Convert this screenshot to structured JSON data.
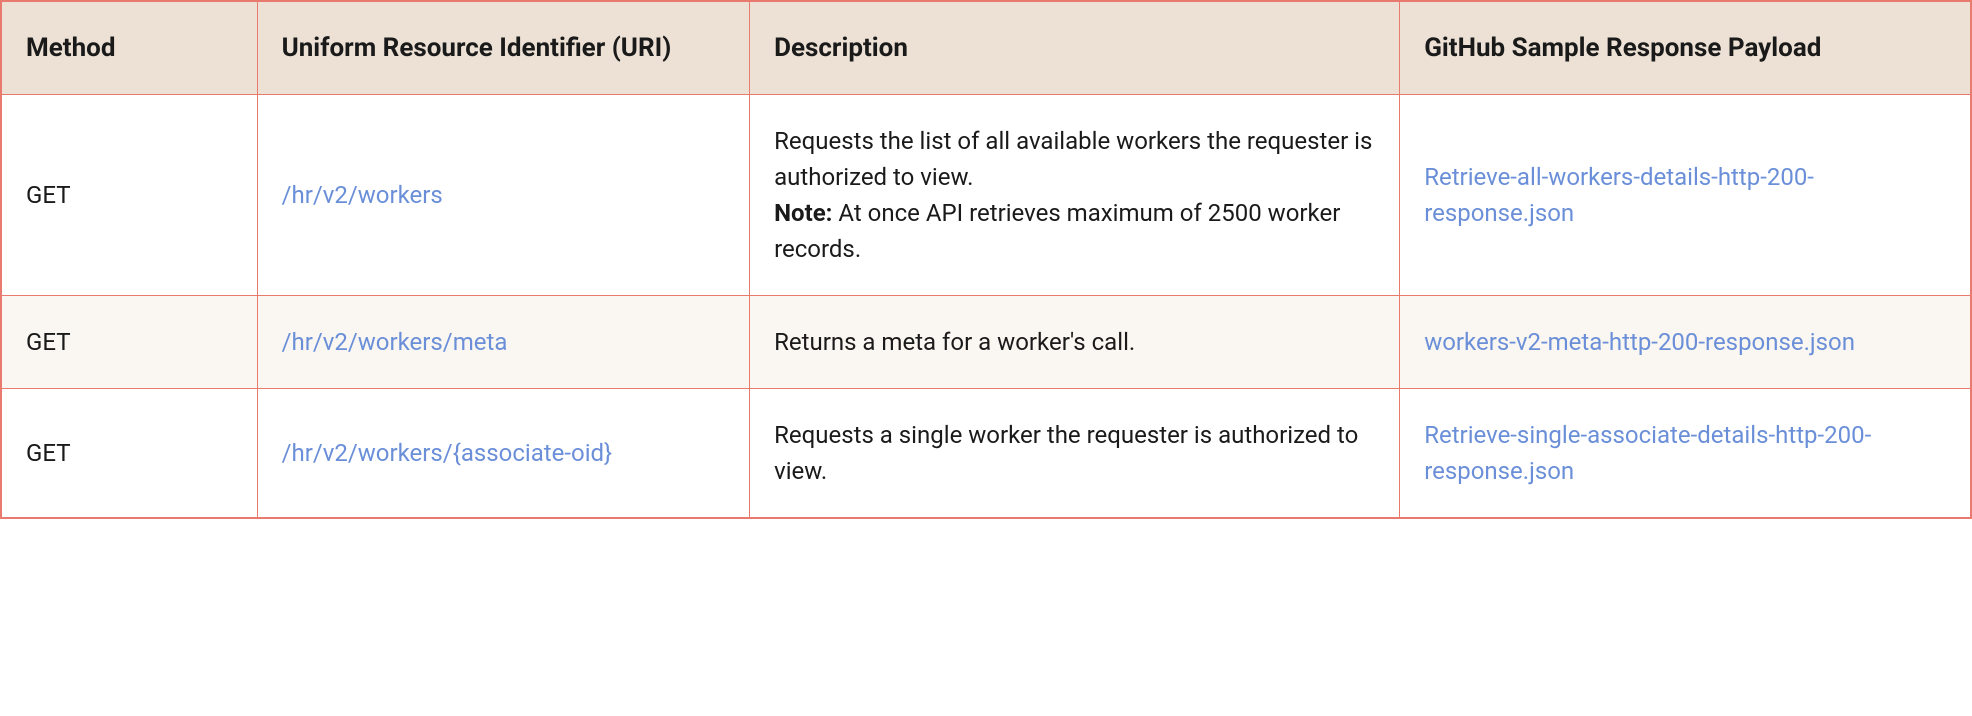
{
  "table": {
    "headers": {
      "method": "Method",
      "uri": "Uniform Resource Identifier (URI)",
      "description": "Description",
      "payload": "GitHub Sample Response Payload"
    },
    "rows": [
      {
        "method": "GET",
        "uri": "/hr/v2/workers",
        "description_main": "Requests the list of all available workers the requester is authorized to view.",
        "note_label": "Note:",
        "note_text": " At once API retrieves maximum of 2500 worker records.",
        "payload": "Retrieve-all-workers-details-http-200-response.json"
      },
      {
        "method": "GET",
        "uri": "/hr/v2/workers/meta",
        "description_main": "Returns a meta for a worker's call.",
        "note_label": "",
        "note_text": "",
        "payload": "workers-v2-meta-http-200-response.json"
      },
      {
        "method": "GET",
        "uri": "/hr/v2/workers/{associate-oid}",
        "description_main": "Requests a single worker the requester is authorized to view.",
        "note_label": "",
        "note_text": "",
        "payload": "Retrieve-single-associate-details-http-200-response.json"
      }
    ]
  }
}
